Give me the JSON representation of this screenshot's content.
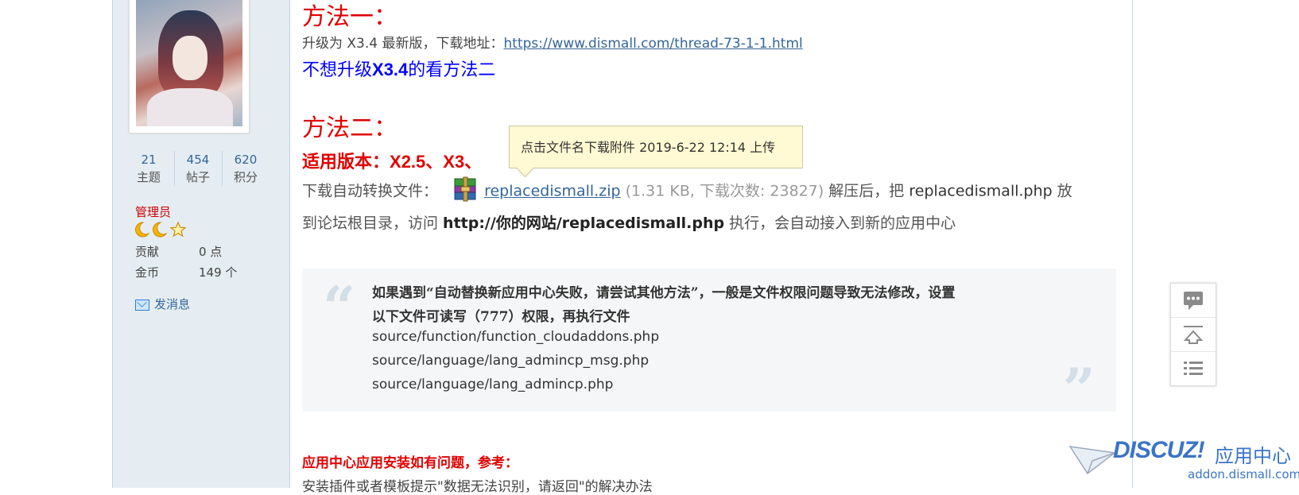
{
  "sidebar": {
    "stats": [
      {
        "value": "21",
        "label": "主题"
      },
      {
        "value": "454",
        "label": "帖子"
      },
      {
        "value": "620",
        "label": "积分"
      }
    ],
    "role": "管理员",
    "stars_icon": "moon-moon-star-icon",
    "contribution_label": "贡献",
    "contribution_value": "0 点",
    "coins_label": "金币",
    "coins_value": "149 个",
    "message_link": "发消息"
  },
  "post": {
    "method1_title": "方法一：",
    "method1_text": "升级为 X3.4 最新版，下载地址：",
    "method1_url": "https://www.dismall.com/thread-73-1-1.html",
    "no_upgrade_pre": "不想升级",
    "no_upgrade_bold": "X3.4",
    "no_upgrade_post": "的看方法二",
    "method2_title": "方法二：",
    "version_label": "适用版本：",
    "version_values": "X2.5、X3、",
    "download_label": "下载自动转换文件：",
    "attachment_name": "replacedismall.zip",
    "attachment_meta": "(1.31 KB, 下载次数: 23827)",
    "after_unzip": " 解压后，把 ",
    "php_file": "replacedismall.php",
    "put_to": " 放",
    "line2_pre": "到论坛根目录，访问 ",
    "line2_url": "http://你的网站/replacedismall.php",
    "line2_post": " 执行，会自动接入到新的应用中心",
    "tooltip": "点击文件名下载附件   2019-6-22 12:14 上传",
    "quote_line1": "如果遇到“自动替换新应用中心失败，请尝试其他方法”，一般是文件权限问题导致无法修改，设置",
    "quote_line2": "以下文件可读写（777）权限，再执行文件",
    "quote_files": [
      "source/function/function_cloudaddons.php",
      "source/language/lang_admincp_msg.php",
      "source/language/lang_admincp.php"
    ],
    "ref_title": "应用中心应用安装如有问题，参考：",
    "ref_line": "安装插件或者模板提示\"数据无法识别，请返回\"的解决办法"
  },
  "side_tools": [
    "comment-icon",
    "back-to-top-icon",
    "list-icon"
  ],
  "logo": {
    "brand": "DISCUZ!",
    "cn": "应用中心",
    "url": "addon.dismall.com"
  },
  "colors": {
    "red": "#e00000",
    "blue": "#0000ff",
    "link": "#336699",
    "sidebar_bg": "#e5edf2",
    "quote_bg": "#f5f6f7",
    "tooltip_bg": "#fffad3"
  }
}
